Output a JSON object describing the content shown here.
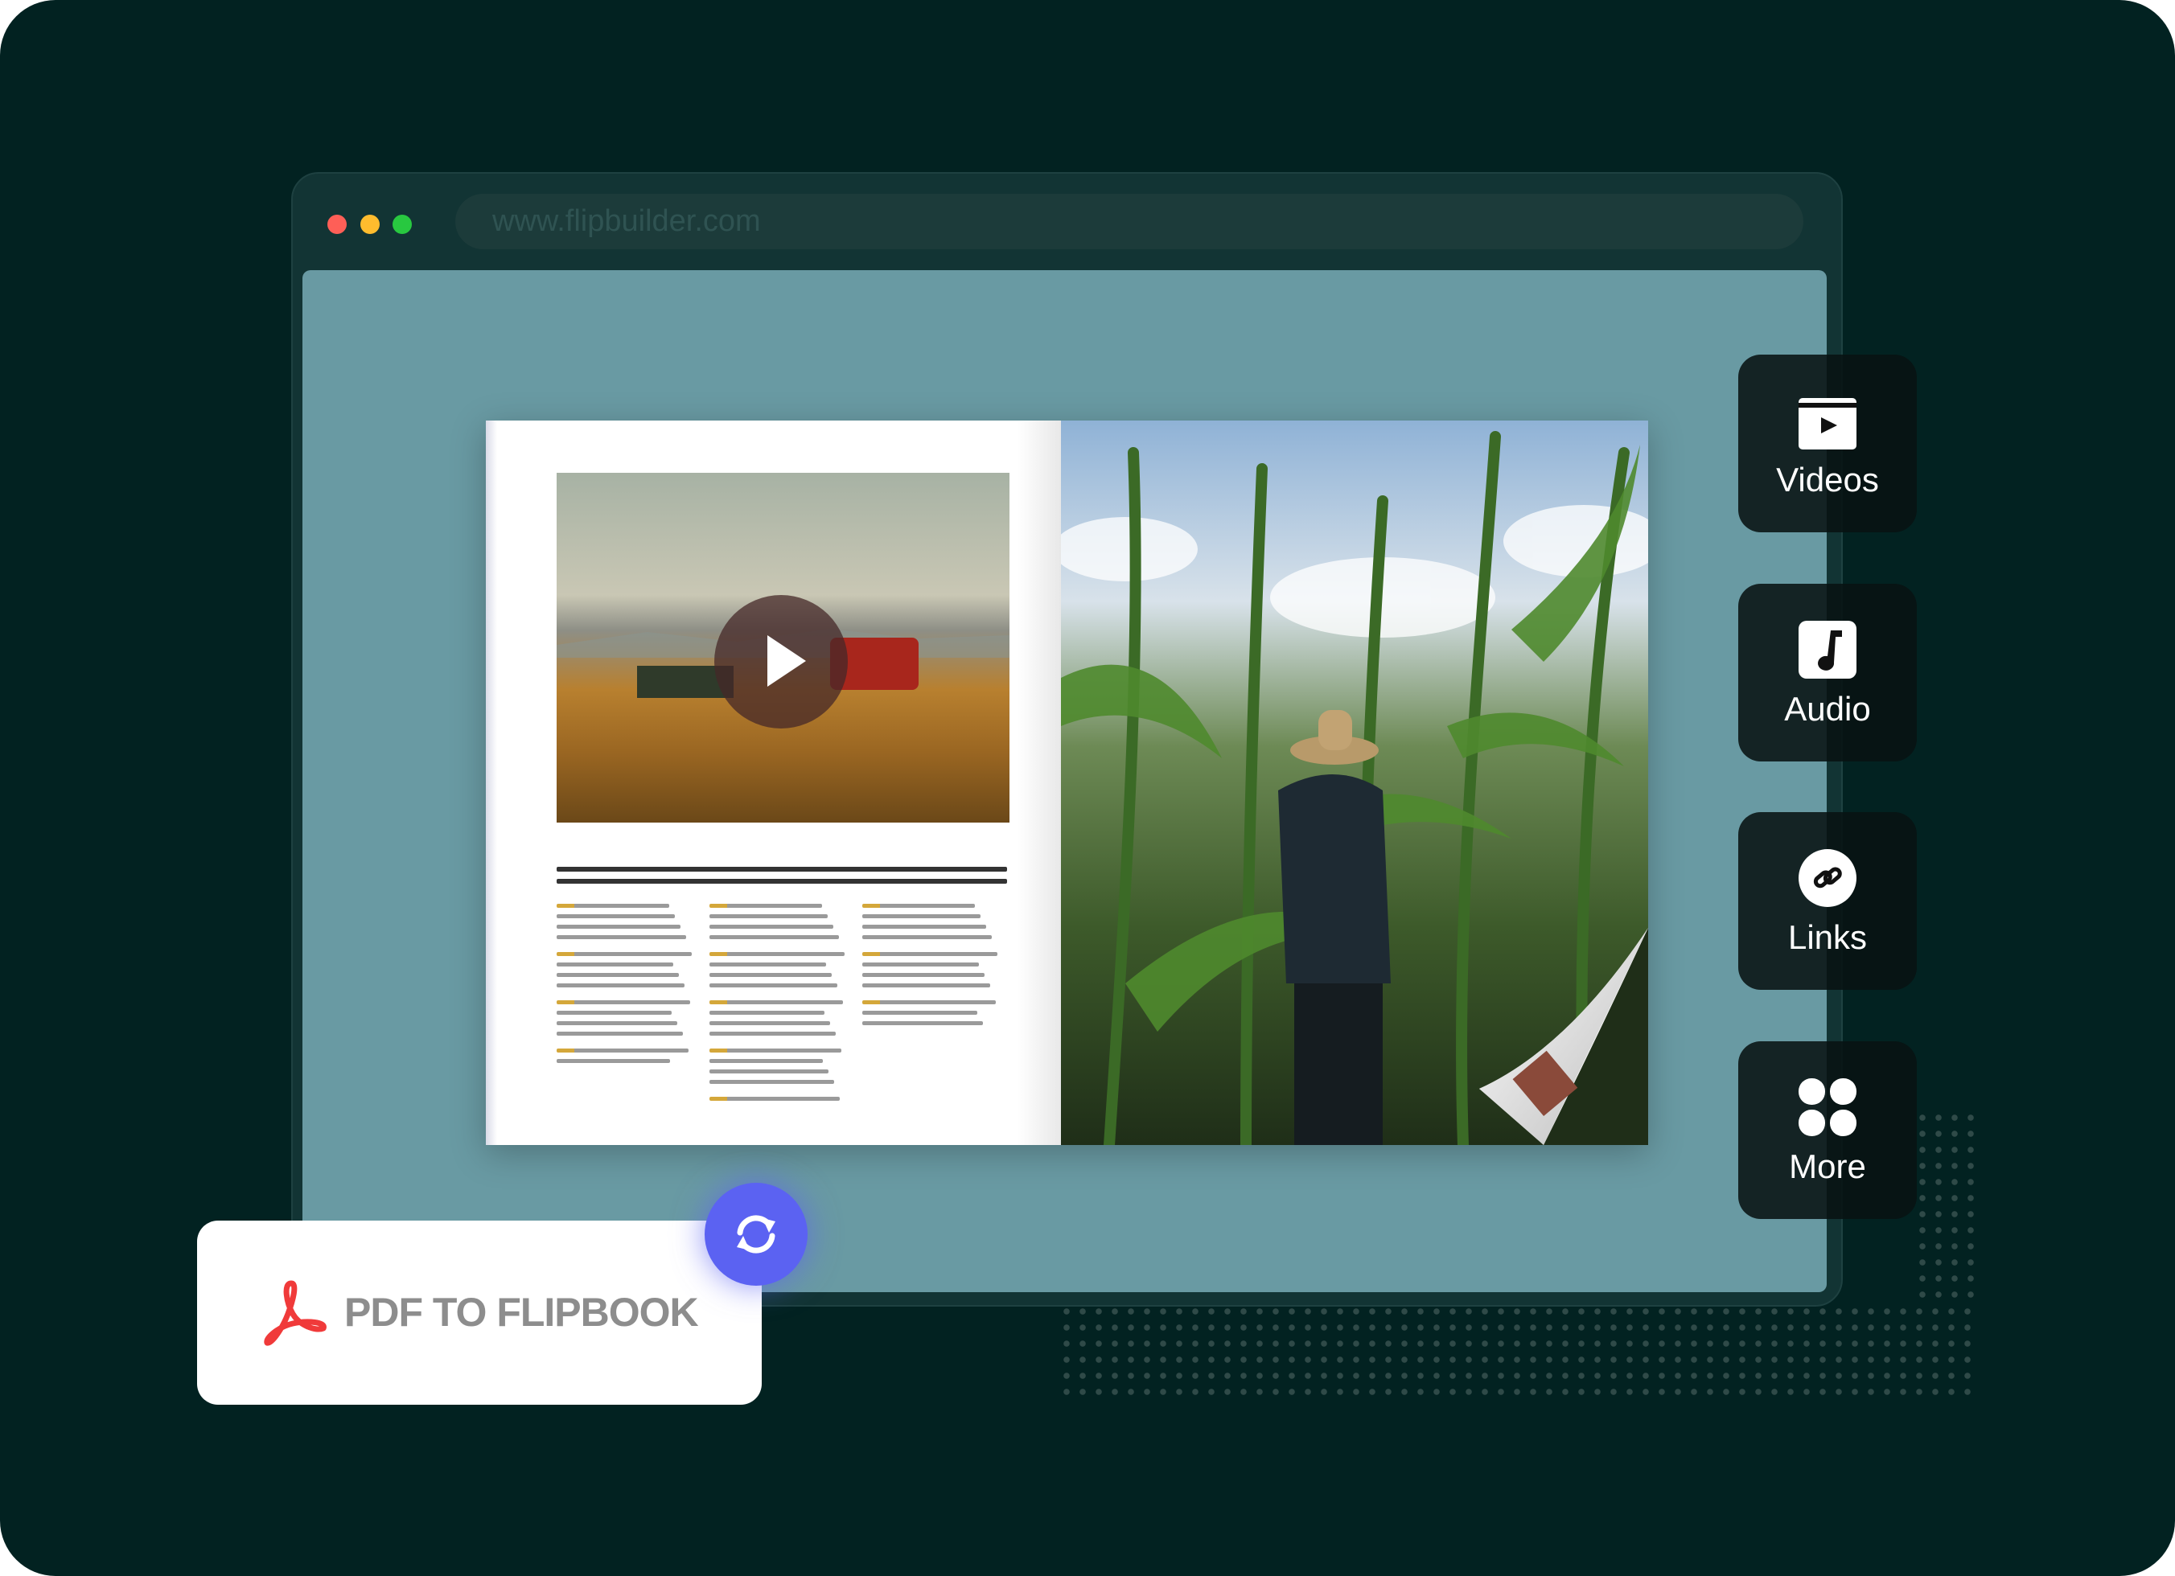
{
  "browser": {
    "url": "www.flipbuilder.com",
    "traffic_lights": [
      "#fe5f57",
      "#febc2e",
      "#28c840"
    ]
  },
  "side_buttons": [
    {
      "label": "Videos",
      "icon": "video-clapper-icon"
    },
    {
      "label": "Audio",
      "icon": "music-note-icon"
    },
    {
      "label": "Links",
      "icon": "link-icon"
    },
    {
      "label": "More",
      "icon": "grid-icon"
    }
  ],
  "badge": {
    "label": "PDF TO FLIPBOOK",
    "icon": "acrobat-pdf-icon",
    "action_icon": "swap-arrows-icon",
    "accent": "#5b62f2"
  }
}
